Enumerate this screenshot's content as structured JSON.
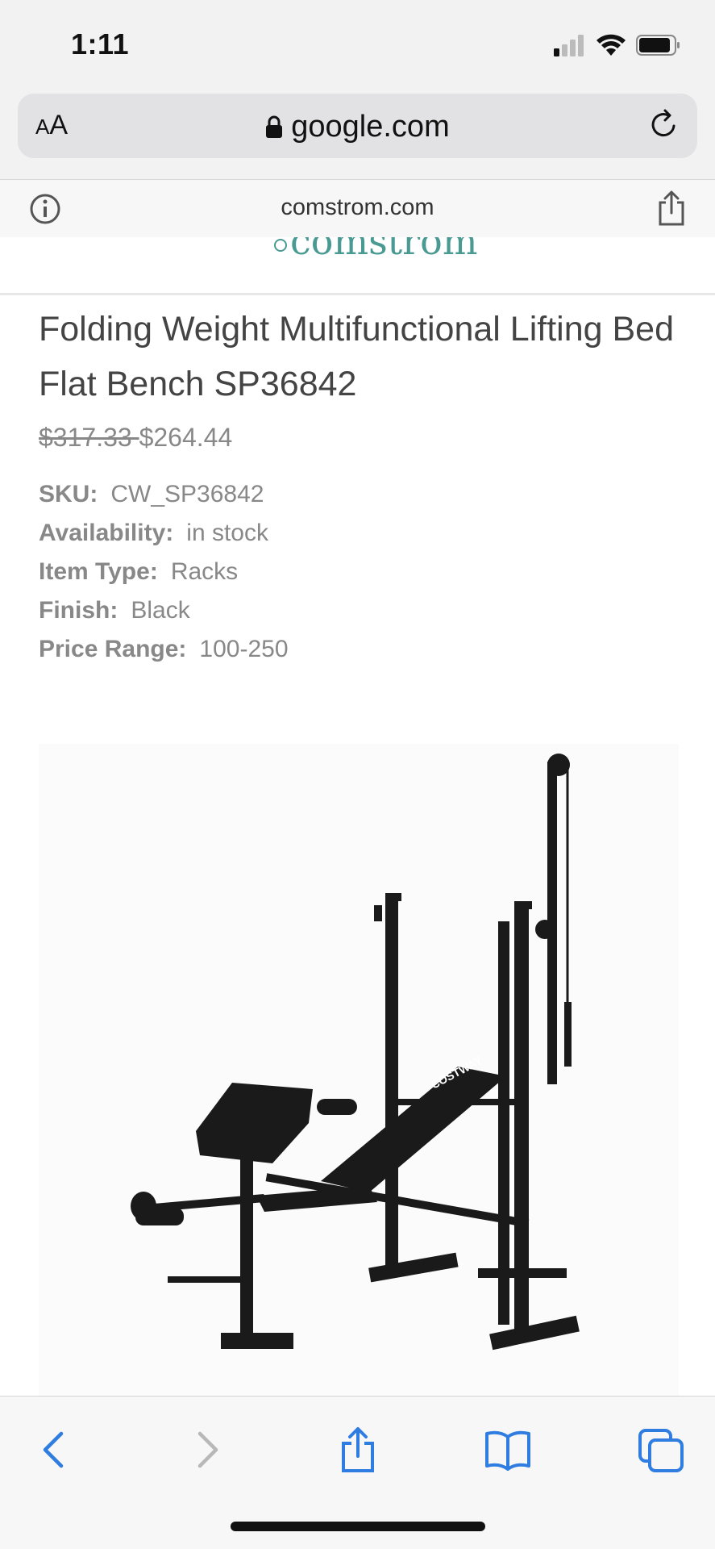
{
  "status_bar": {
    "time": "1:11",
    "icons": [
      "cellular-signal-icon",
      "wifi-icon",
      "battery-icon"
    ]
  },
  "browser": {
    "text_size_label_small": "A",
    "text_size_label_large": "A",
    "url": "google.com",
    "site_domain": "comstrom.com",
    "accent_color": "#2f7de1"
  },
  "site": {
    "logo_text": "comstrom",
    "logo_color": "#4a9a94"
  },
  "product": {
    "title": "Folding Weight Multifunctional Lifting Bed Flat Bench SP36842",
    "price_old": "$317.33 ",
    "price_new": "$264.44",
    "specs": [
      {
        "label": "SKU:",
        "value": "CW_SP36842"
      },
      {
        "label": "Availability:",
        "value": "in stock"
      },
      {
        "label": "Item Type:",
        "value": "Racks"
      },
      {
        "label": "Finish:",
        "value": "Black"
      },
      {
        "label": "Price Range:",
        "value": "100-250"
      }
    ],
    "image_brand_text": "COSTWAY"
  },
  "toolbar": {
    "buttons": [
      "back-icon",
      "forward-icon",
      "share-icon",
      "bookmarks-icon",
      "tabs-icon"
    ]
  }
}
